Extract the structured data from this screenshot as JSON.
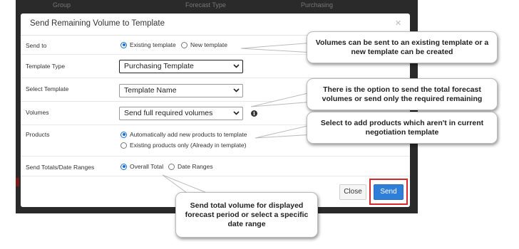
{
  "backdrop": {
    "columns": [
      "Group",
      "Forecast Type",
      "Purchasing"
    ]
  },
  "modal": {
    "title": "Send Remaining Volume to Template",
    "close_symbol": "×",
    "rows": {
      "send_to": {
        "label": "Send to",
        "options": [
          "Existing template",
          "New template"
        ],
        "selected": "Existing template"
      },
      "template_type": {
        "label": "Template Type",
        "value": "Purchasing Template"
      },
      "select_template": {
        "label": "Select Template",
        "value": "Template Name"
      },
      "volumes": {
        "label": "Volumes",
        "value": "Send full required volumes",
        "info_icon": "info-icon"
      },
      "products": {
        "label": "Products",
        "options": [
          "Automatically add new products to template",
          "Existing products only (Already in template)"
        ],
        "selected": "Automatically add new products to template"
      },
      "send_totals": {
        "label": "Send Totals/Date Ranges",
        "options": [
          "Overall Total",
          "Date Ranges"
        ],
        "selected": "Overall Total"
      }
    },
    "buttons": {
      "close": "Close",
      "send": "Send"
    }
  },
  "callouts": {
    "send_to": "Volumes can be sent to an existing template or a new template can be created",
    "volumes": "There is the option to send the total forecast volumes or send only the required remaining",
    "products": "Select to add products which aren't in current negotiation template",
    "date_range": "Send total volume for displayed forecast period or select a specific date range"
  },
  "colors": {
    "accent": "#2f7fd8",
    "highlight": "#d9272e",
    "backdrop": "#2a2a2a"
  }
}
